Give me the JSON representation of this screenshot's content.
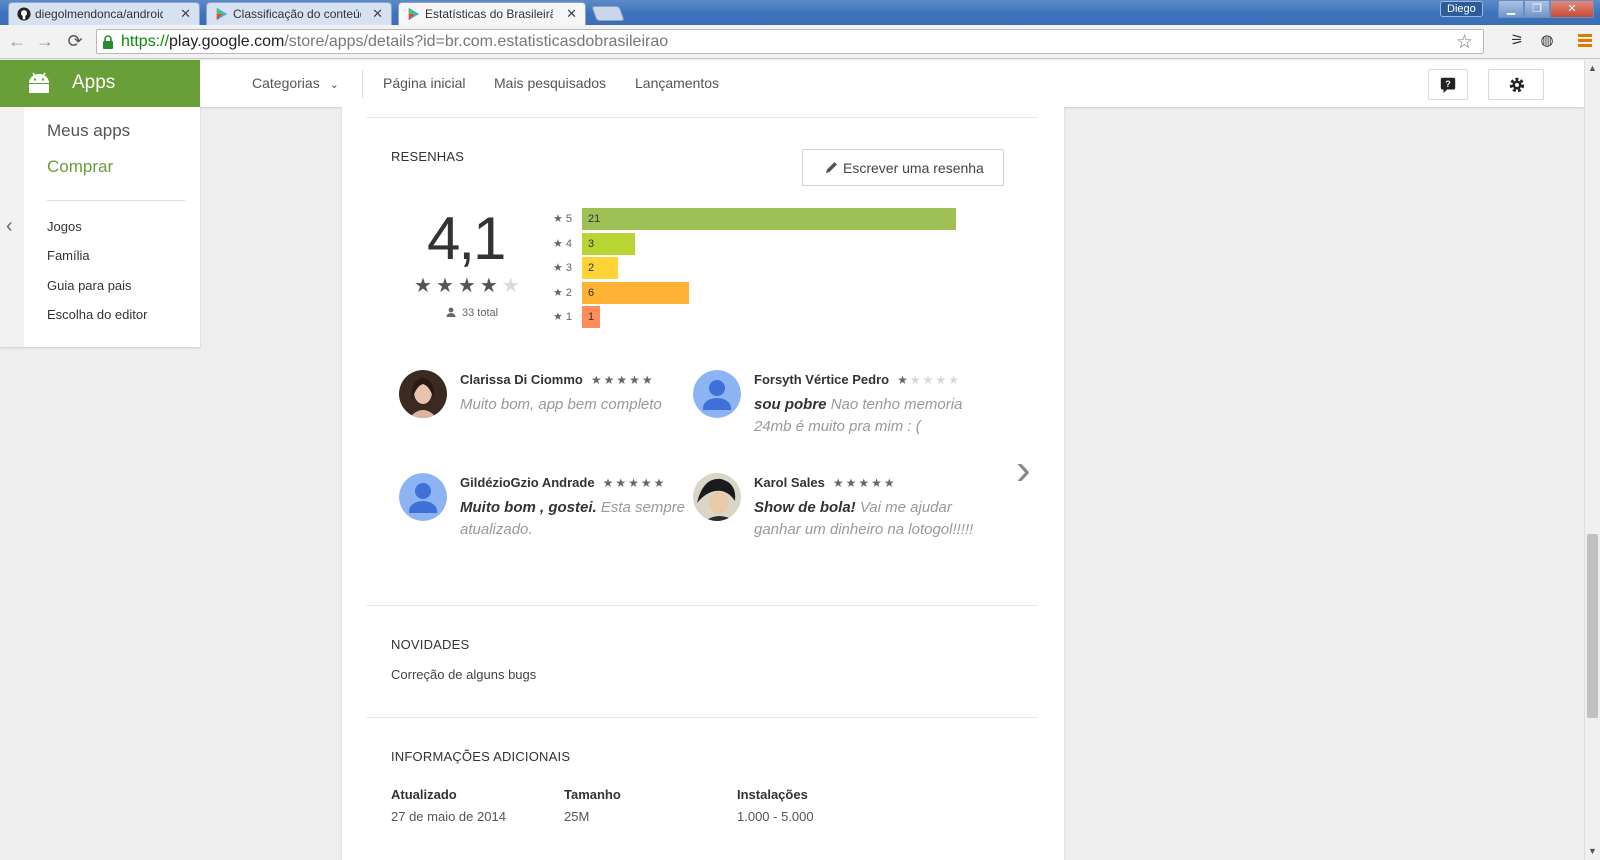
{
  "browser": {
    "tabs": [
      {
        "title": "diegolmendonca/android",
        "active": false
      },
      {
        "title": "Classificação do conteúdo",
        "active": false
      },
      {
        "title": "Estatísticas do Brasileirão",
        "active": true
      }
    ],
    "user": "Diego",
    "url": {
      "scheme": "https://",
      "host": "play.google.com",
      "path": "/store/apps/details?id=br.com.estatisticasdobrasileirao"
    }
  },
  "header": {
    "apps_label": "Apps",
    "categories": "Categorias",
    "nav": [
      "Página inicial",
      "Mais pesquisados",
      "Lançamentos"
    ]
  },
  "sidebar": {
    "my_apps": "Meus apps",
    "shop": "Comprar",
    "items": [
      "Jogos",
      "Família",
      "Guia para pais",
      "Escolha do editor"
    ]
  },
  "reviews": {
    "title": "RESENHAS",
    "write_button": "Escrever uma resenha",
    "score": "4,1",
    "score_stars": 4,
    "total": "33 total",
    "histogram": [
      {
        "stars": "5",
        "count": "21",
        "value": 21,
        "color": "#9fc055"
      },
      {
        "stars": "4",
        "count": "3",
        "value": 3,
        "color": "#b9d534"
      },
      {
        "stars": "3",
        "count": "2",
        "value": 2,
        "color": "#ffd236"
      },
      {
        "stars": "2",
        "count": "6",
        "value": 6,
        "color": "#ffb234"
      },
      {
        "stars": "1",
        "count": "1",
        "value": 1,
        "color": "#ff8c5a"
      }
    ],
    "items": [
      {
        "name": "Clarissa Di Ciommo",
        "rating": 5,
        "title": "",
        "text": "Muito bom, app bem completo",
        "avatar": "photo-female"
      },
      {
        "name": "Forsyth Vértice Pedro",
        "rating": 1,
        "title": "sou pobre",
        "text": "Nao tenho memoria 24mb é muito pra mim : (",
        "avatar": "default-person"
      },
      {
        "name": "GildézioGzio Andrade",
        "rating": 5,
        "title": "Muito bom , gostei.",
        "text": "Esta sempre atualizado.",
        "avatar": "default-person"
      },
      {
        "name": "Karol Sales",
        "rating": 5,
        "title": "Show de bola!",
        "text": "Vai me ajudar ganhar um dinheiro na lotogol!!!!!",
        "avatar": "photo-female-2"
      }
    ]
  },
  "whats_new": {
    "title": "NOVIDADES",
    "text": "Correção de alguns bugs"
  },
  "additional_info": {
    "title": "INFORMAÇÕES ADICIONAIS",
    "fields": [
      {
        "label": "Atualizado",
        "value": "27 de maio de 2014"
      },
      {
        "label": "Tamanho",
        "value": "25M"
      },
      {
        "label": "Instalações",
        "value": "1.000 - 5.000"
      }
    ]
  }
}
